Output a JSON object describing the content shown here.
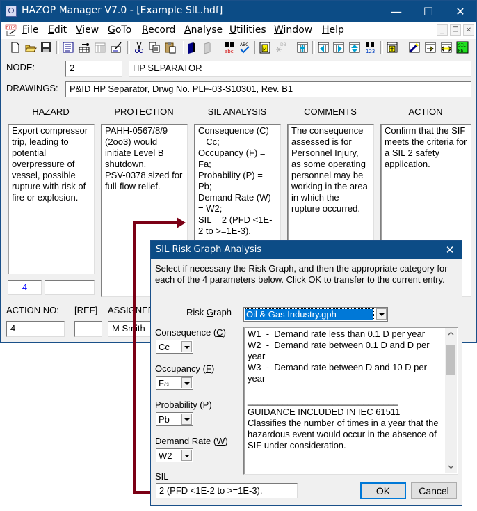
{
  "app": {
    "title": "HAZOP Manager V7.0 - [Example SIL.hdf]",
    "window_controls": {
      "minimize": "—",
      "maximize": "☐",
      "close": "✕"
    }
  },
  "menu": {
    "items": [
      {
        "label": "File",
        "mnemonic": "F"
      },
      {
        "label": "Edit",
        "mnemonic": "E"
      },
      {
        "label": "View",
        "mnemonic": "V"
      },
      {
        "label": "GoTo",
        "mnemonic": "G"
      },
      {
        "label": "Record",
        "mnemonic": "R"
      },
      {
        "label": "Analyse",
        "mnemonic": "A"
      },
      {
        "label": "Utilities",
        "mnemonic": "U"
      },
      {
        "label": "Window",
        "mnemonic": "W"
      },
      {
        "label": "Help",
        "mnemonic": "H"
      }
    ],
    "mdi_controls": {
      "minimize": "_",
      "restore": "❐",
      "close": "✕"
    }
  },
  "toolbar": {
    "buttons": [
      "new-file-icon",
      "open-folder-icon",
      "save-icon",
      "record-list-icon",
      "insert-record-icon",
      "table-grid-icon",
      "edit-form-icon",
      "cut-icon",
      "copy-icon",
      "paste-icon",
      "bookmark-icon",
      "bookmark-disabled-icon",
      "find-text-icon",
      "spell-check-icon",
      "memo-icon",
      "database-link-disabled-icon",
      "add-column-icon",
      "previous-column-icon",
      "next-column-icon",
      "expand-row-icon",
      "find-number-icon",
      "new-entry-icon",
      "highlight-icon",
      "transfer-right-icon",
      "transfer-both-icon",
      "sil-risk-graph-icon"
    ],
    "sil_button_text": "SIL RG"
  },
  "form": {
    "node_label": "NODE:",
    "node_number": "2",
    "node_name": "HP SEPARATOR",
    "drawings_label": "DRAWINGS:",
    "drawings_value": "P&ID HP Separator, Drwg No. PLF-03-S10301, Rev. B1",
    "columns": [
      {
        "header": "HAZARD",
        "text": "Export compressor trip, leading to potential overpressure of vessel, possible rupture with risk of fire or explosion."
      },
      {
        "header": "PROTECTION",
        "text": "PAHH-0567/8/9 (2oo3) would initiate Level B shutdown.\nPSV-0378 sized for full-flow relief."
      },
      {
        "header": "SIL ANALYSIS",
        "text": "Consequence (C) = Cc;\nOccupancy (F) = Fa;\nProbability (P) = Pb;\nDemand Rate (W) = W2;\nSIL = 2 (PFD <1E-2 to >=1E-3)."
      },
      {
        "header": "COMMENTS",
        "text": "The consequence assessed is for Personnel Injury, as some operating personnel may be working in the area in which the rupture occurred."
      },
      {
        "header": "ACTION",
        "text": "Confirm that the SIF meets the criteria for a SIL 2 safety application."
      }
    ],
    "hazard_number": "4",
    "hazard_extra": "",
    "action_no_label": "ACTION NO:",
    "ref_label": "[REF]",
    "assigned_label": "ASSIGNED",
    "action_no_value": "4",
    "ref_value": "",
    "assigned_value": "M Smith"
  },
  "dialog": {
    "title": "SIL Risk Graph Analysis",
    "close": "✕",
    "instructions": "Select if necessary the Risk Graph, and then the appropriate category for each of the 4 parameters below.  Click OK to transfer to the current entry.",
    "risk_graph_label": "Risk Graph",
    "risk_graph_mnemonic": "G",
    "risk_graph_value": "Oil & Gas Industry.gph",
    "params": [
      {
        "label_pre": "Consequence (",
        "key": "C",
        "label_post": ")",
        "value": "Cc"
      },
      {
        "label_pre": "Occupancy (",
        "key": "F",
        "label_post": ")",
        "value": "Fa"
      },
      {
        "label_pre": "Probability (",
        "key": "P",
        "label_post": ")",
        "value": "Pb"
      },
      {
        "label_pre": "Demand Rate (",
        "key": "W",
        "label_post": ")",
        "value": "W2"
      }
    ],
    "guidance_lines": [
      "W1  -  Demand rate less than 0.1 D per year",
      "W2  -  Demand rate between 0.1 D and D per year",
      "W3  -  Demand rate between D and 10 D per year"
    ],
    "guidance_divider": "______________________________",
    "guidance_heading": "GUIDANCE INCLUDED IN IEC 61511",
    "guidance_body": "Classifies the number of times in a year that the hazardous event would occur in the absence of SIF under consideration.",
    "sil_label": "SIL",
    "sil_value": "2 (PFD <1E-2 to >=1E-3).",
    "ok_label": "OK",
    "cancel_label": "Cancel"
  },
  "colors": {
    "titlebar": "#0c4c86",
    "connector": "#7b0015",
    "selection": "#0078d7",
    "hazard_number": "#0000ff"
  }
}
